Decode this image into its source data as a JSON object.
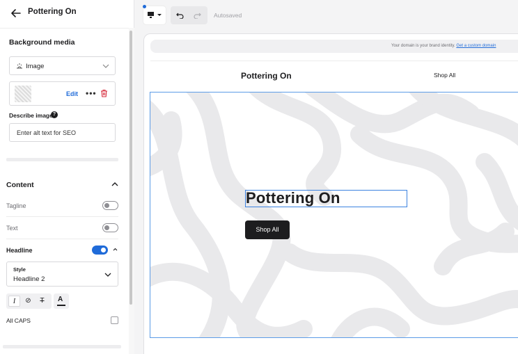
{
  "panel": {
    "title": "Pottering On",
    "background_section": "Background media",
    "media_type": "Image",
    "edit_label": "Edit",
    "more_label": "•••",
    "describe_label": "Describe image",
    "help_glyph": "?",
    "alt_placeholder": "Enter alt text for SEO",
    "content_section": "Content",
    "rows": {
      "tagline": "Tagline",
      "text": "Text",
      "headline": "Headline"
    },
    "toggles": {
      "tagline": false,
      "text": false,
      "headline": true
    },
    "style_caption": "Style",
    "style_value": "Headline 2",
    "format_buttons": [
      "I",
      "⊘",
      "T"
    ],
    "color_glyph": "A",
    "all_caps": "All CAPS",
    "all_caps_checked": false
  },
  "toolbar": {
    "autosaved": "Autosaved"
  },
  "canvas": {
    "domain_text": "Your domain is your brand identity.",
    "domain_link": "Get a custom domain",
    "site_name": "Pottering On",
    "nav_link": "Shop All",
    "headline": "Pottering On",
    "cta": "Shop All"
  },
  "colors": {
    "accent": "#1f6bd9",
    "selection": "#3b82e0",
    "pattern": "#e9e9eb",
    "button": "#1d1d1f"
  },
  "icons": [
    "back-arrow-icon",
    "sun-icon",
    "chevron-down-icon",
    "trash-icon",
    "help-icon",
    "chevron-up-icon",
    "italic-icon",
    "link-icon",
    "clear-format-icon",
    "text-color-icon",
    "desktop-icon",
    "undo-icon",
    "redo-icon"
  ]
}
